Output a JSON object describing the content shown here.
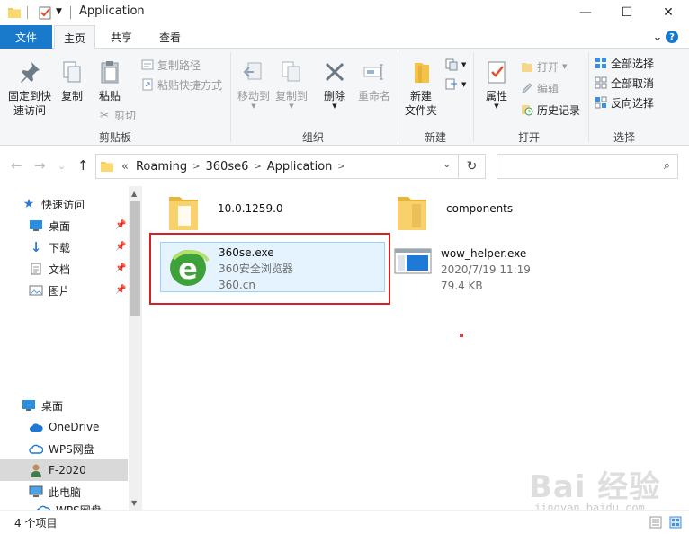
{
  "window": {
    "title": "Application",
    "controls": {
      "minimize": "—",
      "maximize": "☐",
      "close": "✕"
    }
  },
  "tabs": {
    "file": "文件",
    "home": "主页",
    "share": "共享",
    "view": "查看",
    "expand": "⌄",
    "help": "?"
  },
  "ribbon": {
    "clipboard": {
      "label": "剪贴板",
      "pin": "固定到快\n速访问",
      "copy": "复制",
      "paste": "粘贴",
      "copy_path": "复制路径",
      "paste_shortcut": "粘贴快捷方式",
      "cut": "剪切"
    },
    "organize": {
      "label": "组织",
      "move_to": "移动到",
      "copy_to": "复制到",
      "delete": "删除",
      "rename": "重命名"
    },
    "new": {
      "label": "新建",
      "new_folder": "新建\n文件夹"
    },
    "open": {
      "label": "打开",
      "properties": "属性",
      "open": "打开",
      "edit": "编辑",
      "history": "历史记录"
    },
    "select": {
      "label": "选择",
      "select_all": "全部选择",
      "select_none": "全部取消",
      "invert": "反向选择"
    }
  },
  "address": {
    "back": "←",
    "forward": "→",
    "recent": "⌄",
    "up": "↑",
    "overflow": "«",
    "crumbs": [
      "Roaming",
      "360se6",
      "Application"
    ],
    "search_placeholder": ""
  },
  "navpane": {
    "quick_access": "快速访问",
    "items": [
      {
        "label": "桌面"
      },
      {
        "label": "下载"
      },
      {
        "label": "文档"
      },
      {
        "label": "图片"
      }
    ],
    "desktop": "桌面",
    "onedrive": "OneDrive",
    "wps": "WPS网盘",
    "user": "F-2020",
    "this_pc": "此电脑",
    "wps2": "WPS网盘"
  },
  "files": [
    {
      "name": "10.0.1259.0",
      "type": "folder"
    },
    {
      "name": "components",
      "type": "folder"
    },
    {
      "name": "360se.exe",
      "desc1": "360安全浏览器",
      "desc2": "360.cn",
      "type": "exe"
    },
    {
      "name": "wow_helper.exe",
      "desc1": "2020/7/19 11:19",
      "desc2": "79.4 KB",
      "type": "exe"
    }
  ],
  "status": {
    "count": "4 个项目"
  },
  "watermark": {
    "main": "Bai 经验",
    "sub": "jingyan.baidu.com"
  },
  "colors": {
    "accent": "#1979ca",
    "highlight_box": "#d71f26",
    "selection_bg": "#e5f3ff"
  }
}
